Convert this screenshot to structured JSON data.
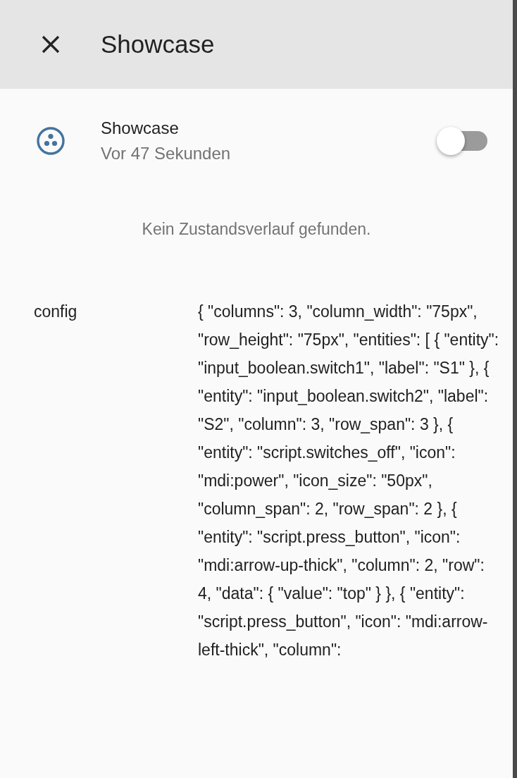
{
  "dialog": {
    "title": "Showcase"
  },
  "entity": {
    "name": "Showcase",
    "last_changed": "Vor 47 Sekunden",
    "on": false
  },
  "history_message": "Kein Zustandsverlauf gefunden.",
  "attributes": [
    {
      "name": "config",
      "value": "{ \"columns\": 3, \"column_width\": \"75px\", \"row_height\": \"75px\", \"entities\": [ { \"entity\": \"input_boolean.switch1\", \"label\": \"S1\" }, { \"entity\": \"input_boolean.switch2\", \"label\": \"S2\", \"column\": 3, \"row_span\": 3 }, { \"entity\": \"script.switches_off\", \"icon\": \"mdi:power\", \"icon_size\": \"50px\", \"column_span\": 2, \"row_span\": 2 }, { \"entity\": \"script.press_button\", \"icon\": \"mdi:arrow-up-thick\", \"column\": 2, \"row\": 4, \"data\": { \"value\": \"top\" } }, { \"entity\": \"script.press_button\", \"icon\": \"mdi:arrow-left-thick\", \"column\":"
    }
  ]
}
